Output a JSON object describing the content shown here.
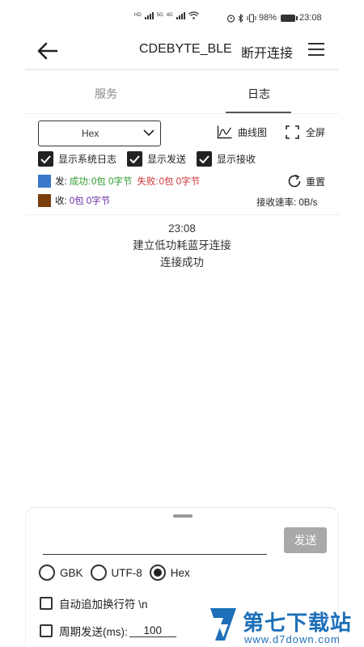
{
  "status_bar": {
    "net_small_1": "HD",
    "net_small_2": "5G",
    "net_small_3": "4G",
    "battery_percent": "98%",
    "time": "23:08"
  },
  "toolbar": {
    "device_name": "CDEBYTE_BLE",
    "disconnect_label": "断开连接"
  },
  "tabs": [
    {
      "label": "服务",
      "active": false
    },
    {
      "label": "日志",
      "active": true
    }
  ],
  "controls": {
    "format_selected": "Hex",
    "curve_label": "曲线图",
    "fullscreen_label": "全屏",
    "checkboxes": [
      {
        "label": "显示系统日志",
        "checked": true
      },
      {
        "label": "显示发送",
        "checked": true
      },
      {
        "label": "显示接收",
        "checked": true
      }
    ],
    "reset_label": "重置"
  },
  "stats": {
    "send": {
      "color": "#3a78c9",
      "prefix": "发:",
      "success_label": "成功:",
      "success_value": "0包 0字节",
      "fail_label": "失败:",
      "fail_value": "0包 0字节"
    },
    "receive": {
      "color": "#7a3d0c",
      "prefix": "收:",
      "value": "0包 0字节"
    },
    "rate_label": "接收速率:",
    "rate_value": "0B/s"
  },
  "log_lines": [
    "23:08",
    "建立低功耗蓝牙连接",
    "连接成功"
  ],
  "bottom_panel": {
    "send_input_value": "",
    "send_button": "发送",
    "encodings": [
      {
        "label": "GBK",
        "selected": false
      },
      {
        "label": "UTF-8",
        "selected": false
      },
      {
        "label": "Hex",
        "selected": true
      }
    ],
    "auto_newline_label": "自动追加换行符 \\n",
    "periodic_label": "周期发送(ms):",
    "periodic_value": "100"
  },
  "watermark": {
    "title": "第七下载站",
    "url": "www.d7down.com"
  }
}
